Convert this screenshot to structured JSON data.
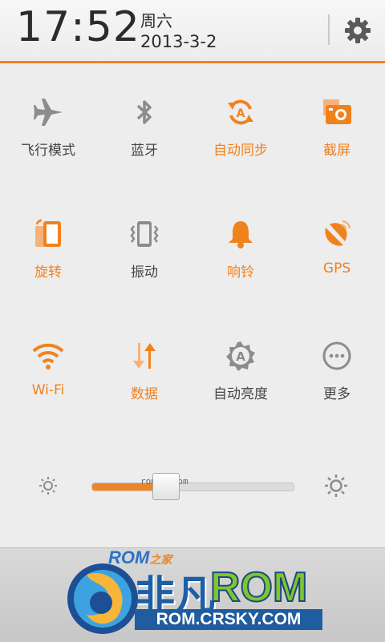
{
  "header": {
    "time": "17:52",
    "weekday": "周六",
    "date": "2013-3-2"
  },
  "toggles": [
    {
      "id": "airplane",
      "label": "飞行模式",
      "icon": "airplane-icon",
      "state": "off"
    },
    {
      "id": "bluetooth",
      "label": "蓝牙",
      "icon": "bluetooth-icon",
      "state": "off"
    },
    {
      "id": "sync",
      "label": "自动同步",
      "icon": "sync-icon",
      "state": "on"
    },
    {
      "id": "screenshot",
      "label": "截屏",
      "icon": "screenshot-icon",
      "state": "on"
    },
    {
      "id": "rotate",
      "label": "旋转",
      "icon": "rotate-icon",
      "state": "on"
    },
    {
      "id": "vibrate",
      "label": "振动",
      "icon": "vibrate-icon",
      "state": "off"
    },
    {
      "id": "ring",
      "label": "响铃",
      "icon": "bell-icon",
      "state": "on"
    },
    {
      "id": "gps",
      "label": "GPS",
      "icon": "gps-icon",
      "state": "on"
    },
    {
      "id": "wifi",
      "label": "Wi-Fi",
      "icon": "wifi-icon",
      "state": "on"
    },
    {
      "id": "data",
      "label": "数据",
      "icon": "data-icon",
      "state": "on"
    },
    {
      "id": "autobright",
      "label": "自动亮度",
      "icon": "auto-brightness-icon",
      "state": "off"
    },
    {
      "id": "more",
      "label": "更多",
      "icon": "more-icon",
      "state": "off"
    }
  ],
  "brightness": {
    "level": 0.31,
    "watermark": "romzj.com"
  },
  "banner": {
    "small_logo": "ROM",
    "small_logo_suffix": "之家",
    "title_cn": "非凡",
    "title_en": "ROM",
    "url": "ROM.CRSKY.COM"
  },
  "colors": {
    "accent": "#f0821e",
    "inactive": "#8c8c8c"
  }
}
